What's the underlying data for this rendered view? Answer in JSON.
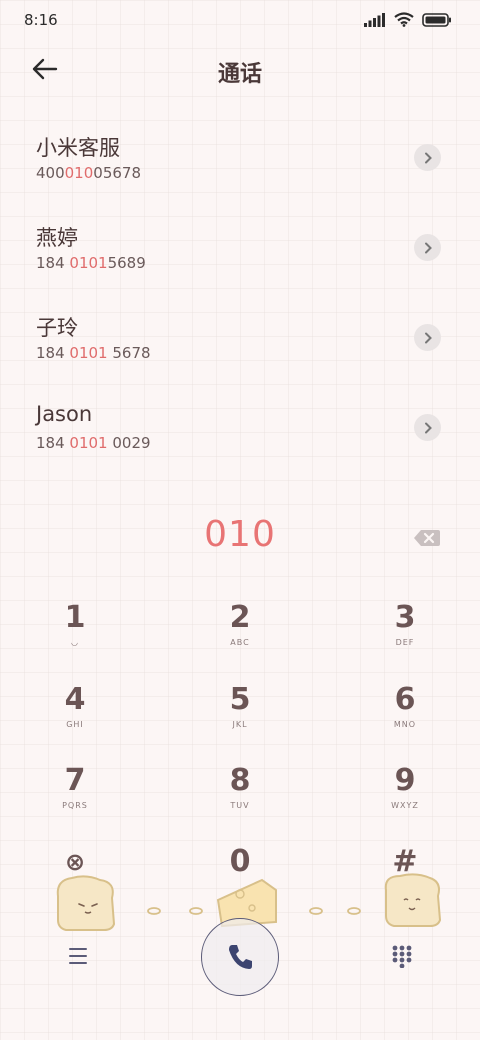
{
  "status_bar": {
    "time": "8:16",
    "icons": [
      "signal-icon",
      "wifi-icon",
      "battery-icon"
    ]
  },
  "header": {
    "title": "通话",
    "back_icon": "back-arrow-icon"
  },
  "contacts": [
    {
      "name": "小米客服",
      "number_parts": [
        "400",
        "010",
        "05678"
      ]
    },
    {
      "name": "燕婷",
      "number_parts": [
        "184 ",
        "0101",
        "5689"
      ]
    },
    {
      "name": "子玲",
      "number_parts": [
        "184 ",
        "0101",
        " 5678"
      ]
    },
    {
      "name": "Jason",
      "number_parts": [
        "184 ",
        "0101",
        " 0029"
      ]
    }
  ],
  "dialer": {
    "typed_number": "010",
    "keys": [
      {
        "digit": "1",
        "letters": "◡"
      },
      {
        "digit": "2",
        "letters": "ABC"
      },
      {
        "digit": "3",
        "letters": "DEF"
      },
      {
        "digit": "4",
        "letters": "GHI"
      },
      {
        "digit": "5",
        "letters": "JKL"
      },
      {
        "digit": "6",
        "letters": "MNO"
      },
      {
        "digit": "7",
        "letters": "PQRS"
      },
      {
        "digit": "8",
        "letters": "TUV"
      },
      {
        "digit": "9",
        "letters": "WXYZ"
      },
      {
        "digit": "⊗",
        "letters": ""
      },
      {
        "digit": "0",
        "letters": ""
      },
      {
        "digit": "#",
        "letters": ""
      }
    ]
  },
  "colors": {
    "accent": "#e87474",
    "text": "#4a3838",
    "background": "#fcf6f5"
  }
}
